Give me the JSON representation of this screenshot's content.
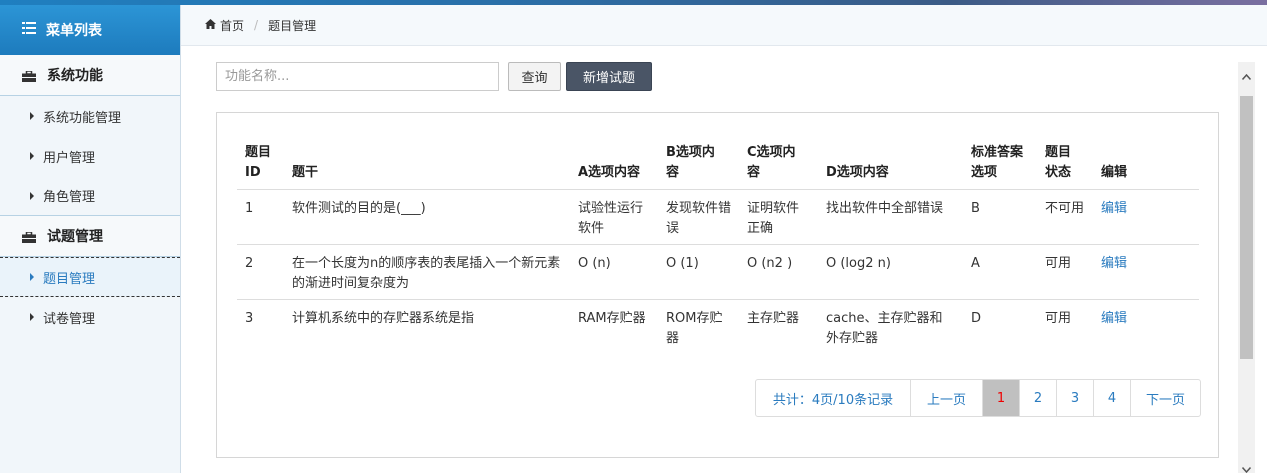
{
  "sidebar": {
    "header": "菜单列表",
    "groups": [
      {
        "title": "系统功能",
        "items": [
          "系统功能管理",
          "用户管理",
          "角色管理"
        ]
      },
      {
        "title": "试题管理",
        "items": [
          "题目管理",
          "试卷管理"
        ]
      }
    ]
  },
  "breadcrumb": {
    "home": "首页",
    "current": "题目管理"
  },
  "search": {
    "placeholder": "功能名称...",
    "query_label": "查询",
    "add_label": "新增试题"
  },
  "table": {
    "headers": [
      [
        "题目",
        "ID"
      ],
      [
        "题干"
      ],
      [
        "A选项内容"
      ],
      [
        "B选项内",
        "容"
      ],
      [
        "C选项内",
        "容"
      ],
      [
        "D选项内容"
      ],
      [
        "标准答案",
        "选项"
      ],
      [
        "题目",
        "状态"
      ],
      [
        "编辑"
      ]
    ],
    "rows": [
      {
        "id": "1",
        "stem": "软件测试的目的是(___)",
        "a": "试验性运行软件",
        "b": "发现软件错误",
        "c": "证明软件正确",
        "d": "找出软件中全部错误",
        "answer": "B",
        "status": "不可用",
        "edit": "编辑"
      },
      {
        "id": "2",
        "stem": "在一个长度为n的顺序表的表尾插入一个新元素的渐进时间复杂度为",
        "a": "O (n)",
        "b": "O (1)",
        "c": "O (n2 )",
        "d": "O (log2 n)",
        "answer": "A",
        "status": "可用",
        "edit": "编辑"
      },
      {
        "id": "3",
        "stem": "计算机系统中的存贮器系统是指",
        "a": "RAM存贮器",
        "b": "ROM存贮器",
        "c": "主存贮器",
        "d": "cache、主存贮器和外存贮器",
        "answer": "D",
        "status": "可用",
        "edit": "编辑"
      }
    ]
  },
  "pagination": {
    "summary": "共计：4页/10条记录",
    "prev": "上一页",
    "pages": [
      "1",
      "2",
      "3",
      "4"
    ],
    "current": "1",
    "next": "下一页"
  },
  "colors": {
    "accent": "#2a7bbf",
    "header": "#1d7bbd",
    "active_page_text": "#e00000"
  }
}
